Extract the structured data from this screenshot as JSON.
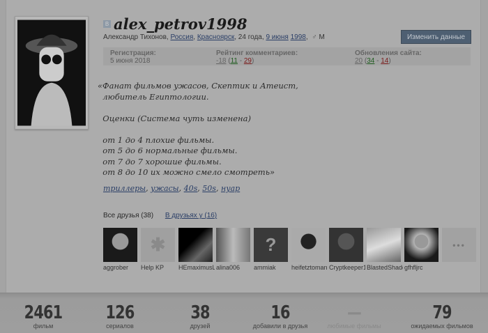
{
  "profile": {
    "username": "alex_petrov1998",
    "vk_badge": "В",
    "name": "Александр Тихонов",
    "country": "Россия",
    "city": "Красноярск",
    "age": "24 года",
    "birth_day": "9 июня",
    "birth_year": "1998",
    "gender": "М",
    "edit_button": "Изменить данные"
  },
  "stats_row": {
    "reg_label": "Регистрация:",
    "reg_value": "5 июня 2018",
    "rating_label": "Рейтинг комментариев:",
    "rating_total": "-18",
    "rating_plus": "11",
    "rating_minus": "29",
    "updates_label": "Обновления сайта:",
    "updates_total": "20",
    "updates_plus": "34",
    "updates_minus": "14"
  },
  "about": "«Фанат фильмов ужасов, Скептик и Атеист,\n  любитель Египтологии.\n\n  Оценки (Система чуть изменена)\n\n  от 1 до 4 плохие фильмы.\n  от 5 до 6 нормальные фильмы.\n  от 7 до 7 хорошие фильмы.\n  от 8 до 10 их можно смело смотреть»",
  "tags": [
    "триллеры",
    "ужасы",
    "40s",
    "50s",
    "нуар"
  ],
  "friends_tabs": {
    "all": "Все друзья (38)",
    "in_friends": "В друзьях у (16)"
  },
  "friends": [
    {
      "name": "aggrober"
    },
    {
      "name": "Help KP"
    },
    {
      "name": "HEmaximusL"
    },
    {
      "name": "alina006"
    },
    {
      "name": "ammiak",
      "placeholder": "?"
    },
    {
      "name": "heifetztoman"
    },
    {
      "name": "Cryptkeeper1"
    },
    {
      "name": "BlastedShadc"
    },
    {
      "name": "gfhfljrc"
    }
  ],
  "more_friends": "•••",
  "bottom_stats": [
    {
      "num": "2461",
      "label": "фильм"
    },
    {
      "num": "126",
      "label": "сериалов"
    },
    {
      "num": "38",
      "label": "друзей"
    },
    {
      "num": "16",
      "label": "добавили в друзья"
    },
    {
      "num": "—",
      "label": "любимые фильмы"
    },
    {
      "num": "79",
      "label": "ожидаемых фильмов"
    }
  ]
}
